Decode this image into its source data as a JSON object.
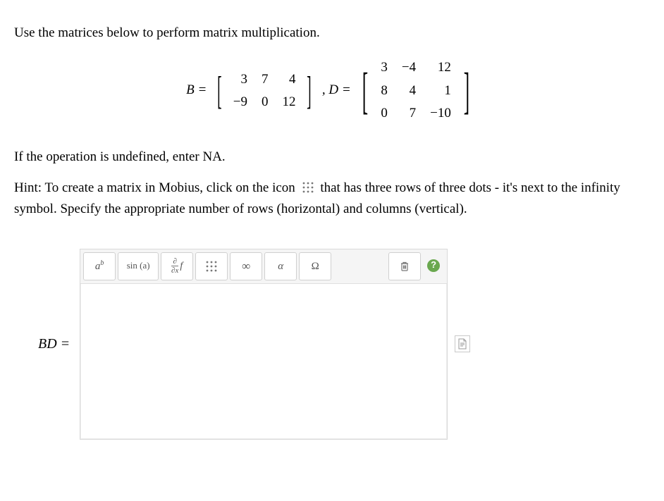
{
  "question": {
    "intro": "Use the matrices below to perform matrix multiplication.",
    "undefined_note": "If the operation is undefined, enter NA.",
    "hint_pre": "Hint: To create a matrix in Mobius, click on the icon ",
    "hint_post": " that has three rows of three dots - it's next to the infinity symbol. Specify the appropriate number of rows (horizontal) and columns (vertical).",
    "B_label": "B",
    "D_label": "D",
    "equals": " = ",
    "comma": ", ",
    "B_matrix": [
      [
        "3",
        "7",
        "4"
      ],
      [
        "−9",
        "0",
        "12"
      ]
    ],
    "D_matrix": [
      [
        "3",
        "−4",
        "12"
      ],
      [
        "8",
        "4",
        "1"
      ],
      [
        "0",
        "7",
        "−10"
      ]
    ],
    "answer_label": "BD ="
  },
  "toolbar": {
    "superscript": "a",
    "superscript_exp": "b",
    "sin": "sin (a)",
    "deriv_top": "∂",
    "deriv_bot": "∂x",
    "deriv_f": "f",
    "infinity": "∞",
    "alpha": "α",
    "omega": "Ω"
  }
}
